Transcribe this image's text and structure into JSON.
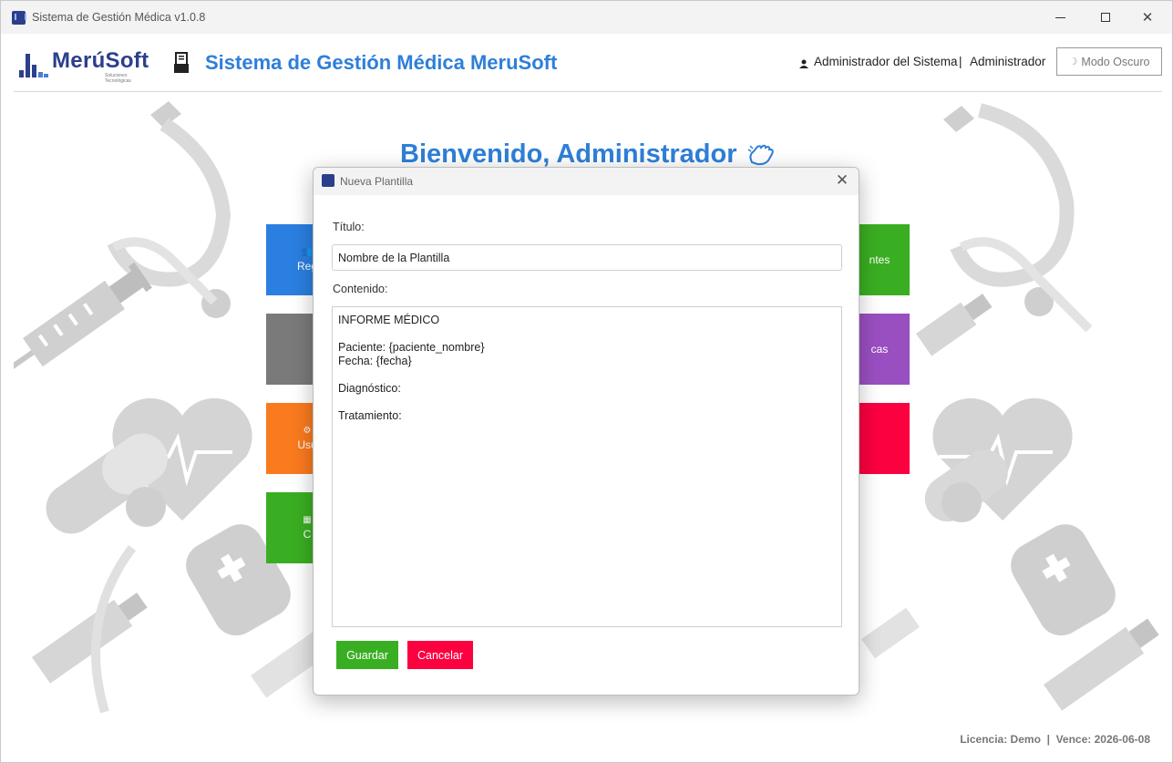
{
  "window": {
    "title": "Sistema de Gestión Médica v1.0.8"
  },
  "header": {
    "logo_text": "MerúSoft",
    "logo_tagline": "Soluciones Tecnológicas",
    "app_title": "Sistema de Gestión Médica MeruSoft",
    "user_name": "Administrador del Sistema",
    "separator": "|",
    "user_role": "Administrador",
    "dark_mode_label": "Modo Oscuro"
  },
  "main": {
    "welcome": "Bienvenido, Administrador",
    "tiles_left": [
      {
        "label": "Reg",
        "icon": "users-icon",
        "color": "#2b7fe0"
      },
      {
        "label": "",
        "icon": "",
        "color": "#7a7a7a"
      },
      {
        "label": "Usu",
        "icon": "gear-icon",
        "color": "#fa7a1e"
      },
      {
        "label": "C",
        "icon": "calendar-icon",
        "color": "#3aae22"
      }
    ],
    "tiles_right": [
      {
        "label": "ntes",
        "color": "#3aae22"
      },
      {
        "label": "cas",
        "color": "#9a4fc1"
      },
      {
        "label": "",
        "color": "#fb0140"
      }
    ]
  },
  "footer": {
    "license": "Licencia: Demo  |  Vence: 2026-06-08"
  },
  "modal": {
    "title": "Nueva Plantilla",
    "title_label": "Título:",
    "title_value": "Nombre de la Plantilla",
    "content_label": "Contenido:",
    "content_value": "INFORME MÉDICO\n\nPaciente: {paciente_nombre}\nFecha: {fecha}\n\nDiagnóstico:\n\nTratamiento:",
    "save_label": "Guardar",
    "cancel_label": "Cancelar"
  }
}
